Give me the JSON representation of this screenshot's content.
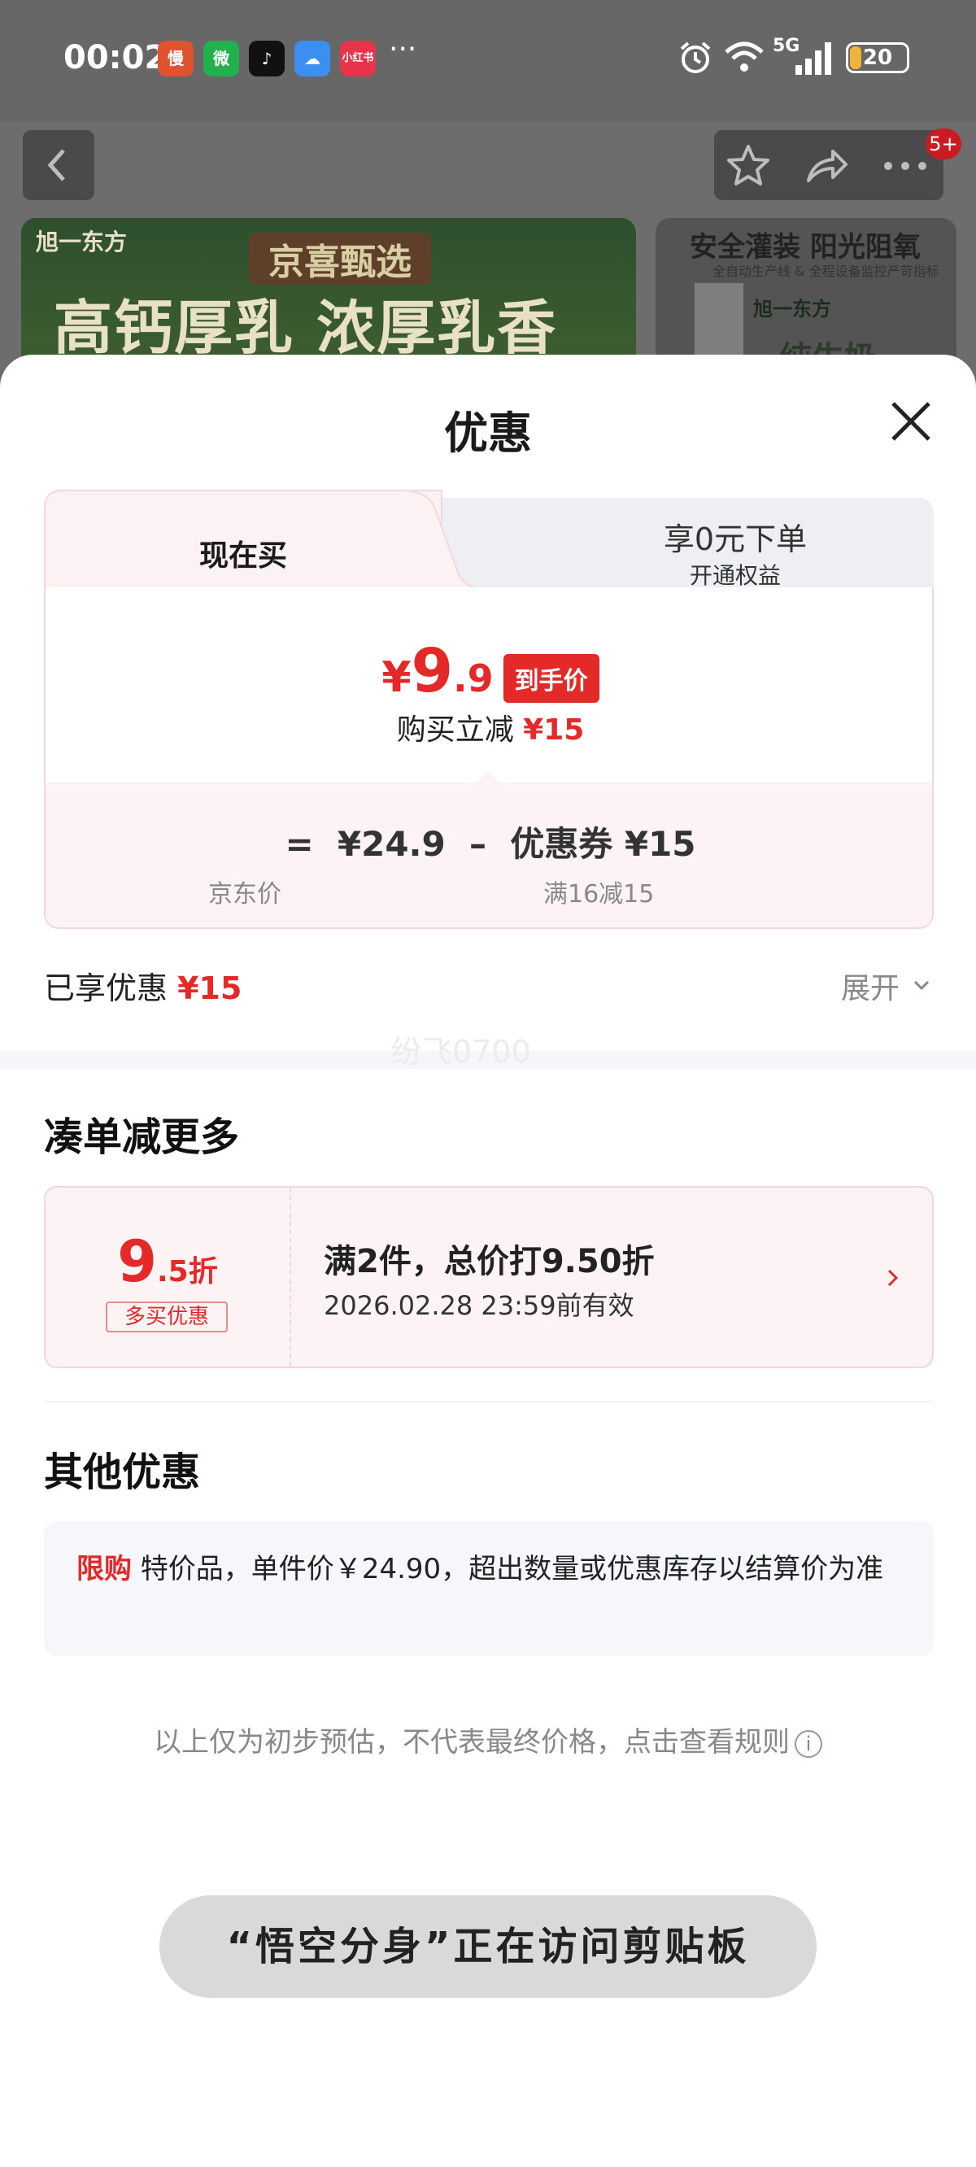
{
  "status_bar": {
    "time": "00:02",
    "apps": [
      {
        "label": "慢",
        "color": "#e0532f",
        "icon": "app-man-icon"
      },
      {
        "label": "微",
        "color": "#22b14c",
        "icon": "wechat-icon"
      },
      {
        "label": "♪",
        "color": "#111111",
        "icon": "tiktok-icon"
      },
      {
        "label": "☁",
        "color": "#3b8ff0",
        "icon": "weather-icon"
      },
      {
        "label": "小红书",
        "color": "#e8344a",
        "icon": "xiaohongshu-icon"
      }
    ],
    "more": "···",
    "network": "5G",
    "battery": "20",
    "battery_level": 0.2
  },
  "background_page": {
    "badge": "5+",
    "banner1_brand": "旭一东方",
    "banner1_sub": "京喜甄选",
    "banner1_main": "高钙厚乳 浓厚乳香",
    "banner2_title": "安全灌装 阳光阻氧",
    "banner2_sub": "全自动生产线 & 全程设备监控严苛指标",
    "banner2_brand": "旭一东方",
    "banner2_milk": "纯牛奶"
  },
  "sheet": {
    "title": "优惠",
    "tabs": {
      "active": "现在买",
      "inactive_main": "享0元下单",
      "inactive_sub": "开通权益"
    },
    "price": {
      "yen": "¥",
      "int": "9",
      "dec": ".9",
      "tag": "到手价",
      "reduce_label": "购买立减",
      "reduce_value": "¥15"
    },
    "calc": {
      "row": "=  ¥24.9  –  优惠券 ¥15",
      "label_left": "京东价",
      "label_right": "满16减15"
    },
    "enjoyed_label": "已享优惠",
    "enjoyed_value": "¥15",
    "expand": "展开",
    "watermark": "纷飞0700"
  },
  "section_more": {
    "title": "凑单减更多",
    "discount_int": "9",
    "discount_dec": ".5折",
    "tag": "多买优惠",
    "desc": "满2件，总价打9.50折",
    "date": "2026.02.28 23:59前有效"
  },
  "section_other": {
    "title": "其他优惠",
    "tag": "限购",
    "text": "特价品，单件价￥24.90，超出数量或优惠库存以结算价为准"
  },
  "disclaimer": "以上仅为初步预估，不代表最终价格，点击查看规则",
  "toast": "“悟空分身”正在访问剪贴板"
}
